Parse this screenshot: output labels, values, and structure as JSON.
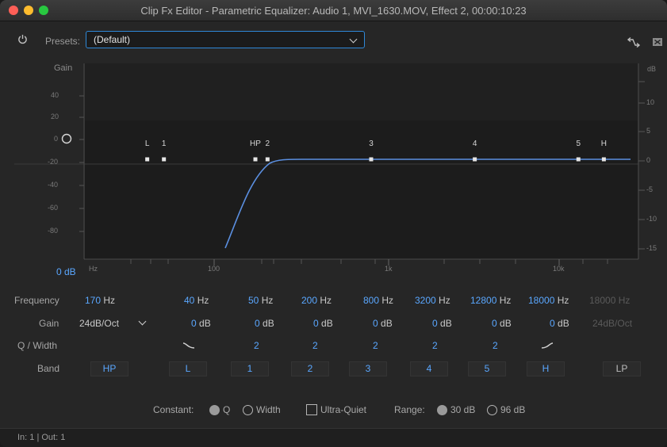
{
  "window": {
    "title": "Clip Fx Editor - Parametric Equalizer: Audio 1, MVI_1630.MOV, Effect 2, 00:00:10:23",
    "traffic_lights": [
      "#ff5f57",
      "#febc2e",
      "#28c840"
    ]
  },
  "toolbar": {
    "presets_label": "Presets:",
    "preset_value": "(Default)"
  },
  "graph": {
    "gain_label": "Gain",
    "db_label": "dB",
    "left_ticks": [
      "40",
      "20",
      "0",
      "-20",
      "-40",
      "-60",
      "-80"
    ],
    "right_ticks": [
      "10",
      "5",
      "0",
      "-5",
      "-10",
      "-15"
    ],
    "freq_ticks": [
      "Hz",
      "100",
      "1k",
      "10k"
    ],
    "master_gain": "0 dB",
    "band_markers": [
      {
        "label": "L",
        "freq_hz": 40,
        "gain_db": 0
      },
      {
        "label": "1",
        "freq_hz": 50,
        "gain_db": 0
      },
      {
        "label": "HP",
        "freq_hz": 170,
        "gain_db": 0
      },
      {
        "label": "2",
        "freq_hz": 200,
        "gain_db": 0
      },
      {
        "label": "3",
        "freq_hz": 800,
        "gain_db": 0
      },
      {
        "label": "4",
        "freq_hz": 3200,
        "gain_db": 0
      },
      {
        "label": "5",
        "freq_hz": 12800,
        "gain_db": 0
      },
      {
        "label": "H",
        "freq_hz": 18000,
        "gain_db": 0
      }
    ]
  },
  "table": {
    "row_labels": {
      "frequency": "Frequency",
      "gain": "Gain",
      "q": "Q / Width",
      "band": "Band"
    },
    "hp": {
      "freq_value": "170",
      "unit": "Hz",
      "gain": "24dB/Oct",
      "band": "HP"
    },
    "bands": [
      {
        "freq": "40",
        "gain": "0",
        "q": "",
        "band": "L"
      },
      {
        "freq": "50",
        "gain": "0",
        "q": "2",
        "band": "1"
      },
      {
        "freq": "200",
        "gain": "0",
        "q": "2",
        "band": "2"
      },
      {
        "freq": "800",
        "gain": "0",
        "q": "2",
        "band": "3"
      },
      {
        "freq": "3200",
        "gain": "0",
        "q": "2",
        "band": "4"
      },
      {
        "freq": "12800",
        "gain": "0",
        "q": "2",
        "band": "5"
      },
      {
        "freq": "18000",
        "gain": "0",
        "q": "",
        "band": "H"
      }
    ],
    "units": {
      "hz": "Hz",
      "db": "dB"
    },
    "lp": {
      "freq": "18000 Hz",
      "gain": "24dB/Oct",
      "band": "LP"
    }
  },
  "options": {
    "constant_label": "Constant:",
    "q_label": "Q",
    "width_label": "Width",
    "ultra_quiet_label": "Ultra-Quiet",
    "range_label": "Range:",
    "range_30": "30 dB",
    "range_96": "96 dB"
  },
  "status": "In: 1 | Out: 1"
}
